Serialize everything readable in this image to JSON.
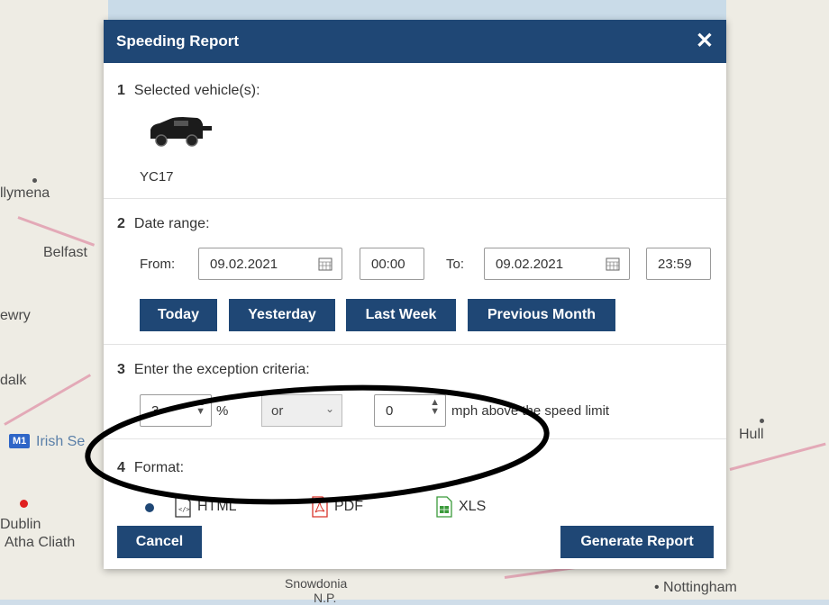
{
  "map": {
    "labels": {
      "ballymena": "llymena",
      "belfast": "Belfast",
      "newry": "ewry",
      "dundalk": "dalk",
      "irish_sea": "Irish Se",
      "motorway": "M1",
      "dublin": "Dublin",
      "baile_atha_cliath": "Atha Cliath",
      "hull": "Hull",
      "snowdonia": "Snowdonia",
      "np": "N.P.",
      "nottingham": "• Nottingham"
    }
  },
  "dialog": {
    "title": "Speeding Report",
    "close": "✕",
    "step1": {
      "num": "1",
      "label": "Selected vehicle(s):",
      "vehicle_plate": "YC17"
    },
    "step2": {
      "num": "2",
      "label": "Date range:",
      "from_label": "From:",
      "from_date": "09.02.2021",
      "from_time": "00:00",
      "to_label": "To:",
      "to_date": "09.02.2021",
      "to_time": "23:59",
      "buttons": {
        "today": "Today",
        "yesterday": "Yesterday",
        "last_week": "Last Week",
        "previous_month": "Previous Month"
      }
    },
    "step3": {
      "num": "3",
      "label": "Enter the exception criteria:",
      "percent_value": "3",
      "percent_unit": "%",
      "operator": "or",
      "mph_value": "0",
      "mph_label": "mph above the speed limit"
    },
    "step4": {
      "num": "4",
      "label": "Format:",
      "options": {
        "html": "HTML",
        "pdf": "PDF",
        "xls": "XLS"
      },
      "selected": "HTML"
    },
    "footer": {
      "cancel": "Cancel",
      "generate": "Generate Report"
    }
  },
  "colors": {
    "header": "#1f4775",
    "pdf": "#d9342b",
    "xls": "#3a9a3a",
    "annotation": "#000000"
  }
}
